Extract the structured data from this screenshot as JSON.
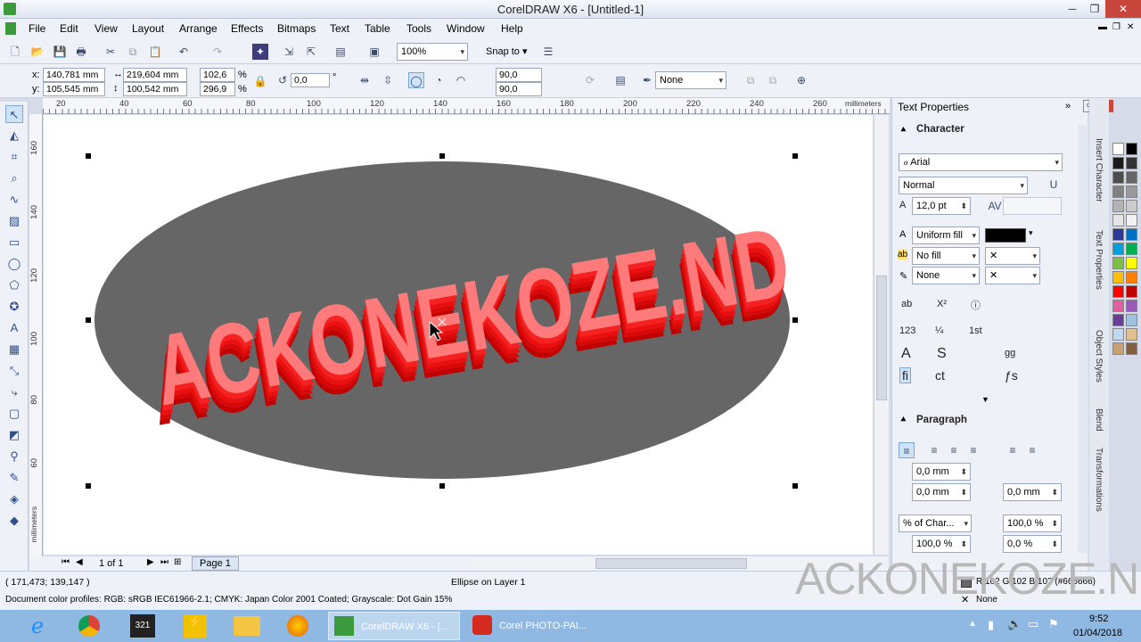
{
  "app_title": "CorelDRAW X6 - [Untitled-1]",
  "menu": [
    "File",
    "Edit",
    "View",
    "Layout",
    "Arrange",
    "Effects",
    "Bitmaps",
    "Text",
    "Table",
    "Tools",
    "Window",
    "Help"
  ],
  "standard_toolbar": {
    "zoom": "100%",
    "snap_to": "Snap to"
  },
  "property_bar": {
    "x_label": "x:",
    "x_value": "140,781 mm",
    "y_label": "y:",
    "y_value": "105,545 mm",
    "w_value": "219,604 mm",
    "h_value": "100,542 mm",
    "scale_w": "102,6",
    "scale_h": "296,9",
    "percent": "%",
    "rotation": "0,0",
    "degree": "°",
    "start_angle": "90,0",
    "end_angle": "90,0",
    "outline": "None"
  },
  "rulers": {
    "unit": "millimeters",
    "h_ticks": [
      "20",
      "40",
      "60",
      "80",
      "100",
      "120",
      "140",
      "160",
      "180",
      "200",
      "220",
      "240",
      "260"
    ],
    "v_ticks": [
      "160",
      "140",
      "120",
      "100",
      "80",
      "60"
    ]
  },
  "canvas": {
    "artwork_text": "ACKONEKOZE.ND",
    "ellipse_color": "#666666",
    "text_color": "#e81010"
  },
  "docker": {
    "title": "Text Properties",
    "character_header": "Character",
    "font": "Arial",
    "style": "Normal",
    "size": "12,0 pt",
    "fill_type": "Uniform fill",
    "bg_fill": "No fill",
    "outline": "None",
    "paragraph_header": "Paragraph",
    "indent_first": "0,0 mm",
    "indent_left": "0,0 mm",
    "indent_right": "0,0 mm",
    "spacing_unit": "% of Char...",
    "line_spacing": "100,0 %",
    "before_spacing": "100,0 %",
    "after_spacing": "0,0 %",
    "ot_labels": [
      "ab",
      "X²",
      "123",
      "A",
      "S",
      "ct",
      "fi",
      "gg",
      "ƒs",
      "1st"
    ]
  },
  "right_tabs": [
    "Insert Character",
    "Text Properties",
    "Object Styles",
    "Blend",
    "Transformations"
  ],
  "palette": [
    "#ffffff",
    "#000000",
    "#1a1a1a",
    "#333333",
    "#4d4d4d",
    "#666666",
    "#808080",
    "#999999",
    "#b3b3b3",
    "#cccccc",
    "#e6e6e6",
    "#f2f2f2",
    "#2b3a9a",
    "#0070c0",
    "#00a0e0",
    "#00b050",
    "#7ac143",
    "#ffff00",
    "#ffc000",
    "#ff8000",
    "#ff0000",
    "#c00000",
    "#e060a0",
    "#9b59b6",
    "#6a3d9a",
    "#a0c0e0",
    "#c0d8f0",
    "#e0c090",
    "#c8a070",
    "#806040"
  ],
  "page_nav": {
    "page_count": "1 of 1",
    "page_tab": "Page 1"
  },
  "status": {
    "coords": "( 171,473; 139,147 )",
    "selection": "Ellipse on Layer 1",
    "color_profiles": "Document color profiles: RGB: sRGB IEC61966-2.1; CMYK: Japan Color 2001 Coated; Grayscale: Dot Gain 15%",
    "fill_info": "R:102 G:102 B:102 (#666666)",
    "outline_info": "None"
  },
  "taskbar": {
    "tasks": [
      "CorelDRAW X6 - [...",
      "Corel PHOTO-PAI..."
    ],
    "time": "9:52",
    "date": "01/04/2018"
  },
  "watermark": "ACKONEKOZE.ND"
}
